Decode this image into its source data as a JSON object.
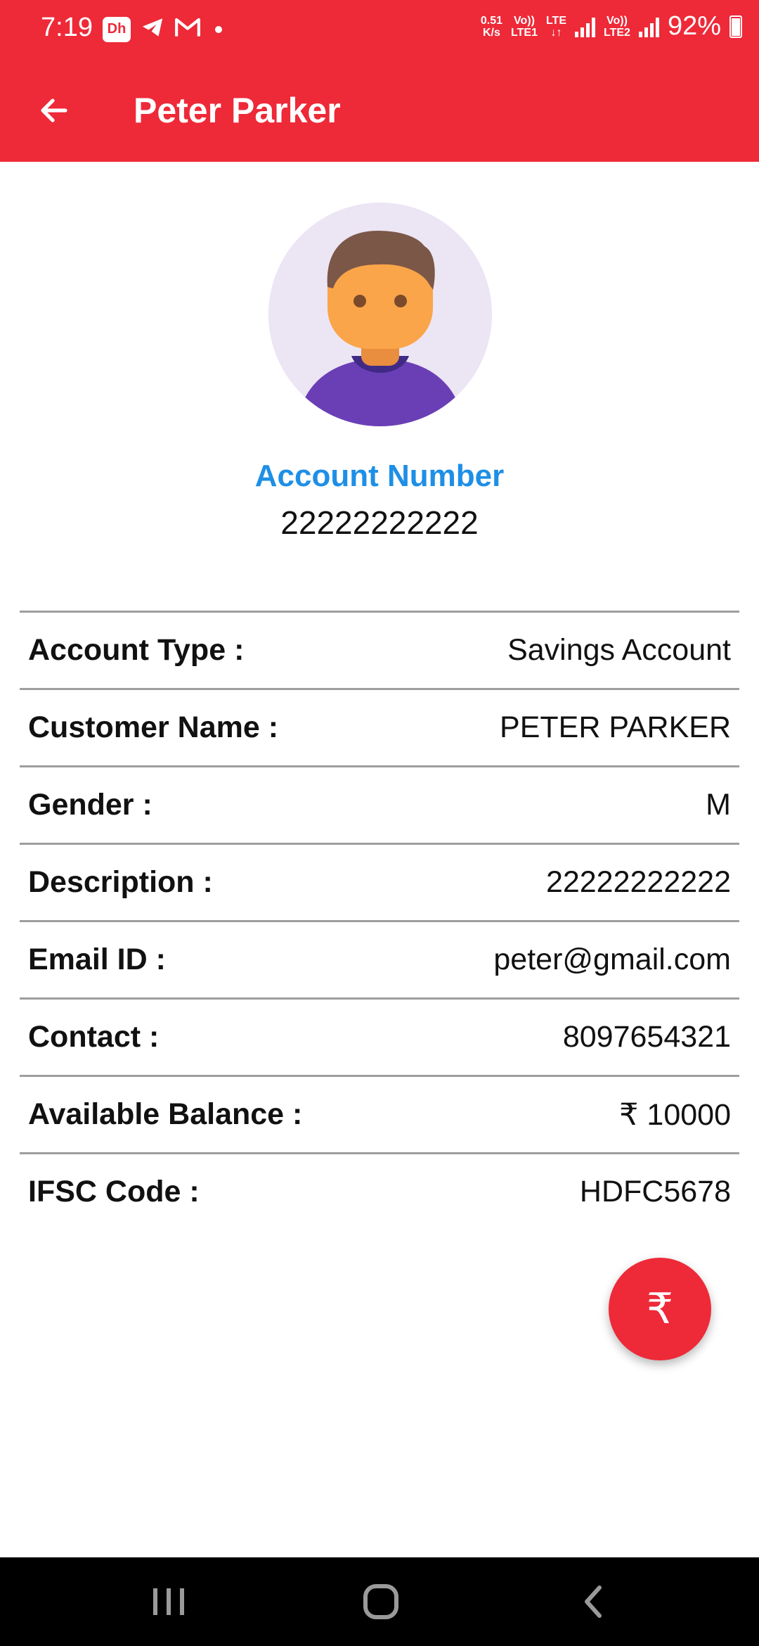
{
  "status_bar": {
    "time": "7:19",
    "app_badge": "Dh",
    "net_speed_top": "0.51",
    "net_speed_bottom": "K/s",
    "sim1_top": "Vo))",
    "sim1_bottom": "LTE1",
    "lte_top": "LTE",
    "lte_bottom": "↓↑",
    "sim2_top": "Vo))",
    "sim2_bottom": "LTE2",
    "battery": "92%"
  },
  "app_bar": {
    "title": "Peter Parker"
  },
  "account": {
    "label": "Account Number",
    "number": "22222222222"
  },
  "details": [
    {
      "label": "Account Type :",
      "value": "Savings Account"
    },
    {
      "label": "Customer Name :",
      "value": "PETER PARKER"
    },
    {
      "label": "Gender :",
      "value": "M"
    },
    {
      "label": "Description :",
      "value": "22222222222"
    },
    {
      "label": "Email ID :",
      "value": "peter@gmail.com"
    },
    {
      "label": "Contact :",
      "value": "8097654321"
    },
    {
      "label": "Available Balance :",
      "value": "₹ 10000"
    },
    {
      "label": "IFSC Code :",
      "value": "HDFC5678"
    }
  ],
  "fab": {
    "icon": "rupee-icon",
    "symbol": "₹"
  },
  "colors": {
    "primary": "#EE2938",
    "accent_blue": "#1E8FE6"
  }
}
